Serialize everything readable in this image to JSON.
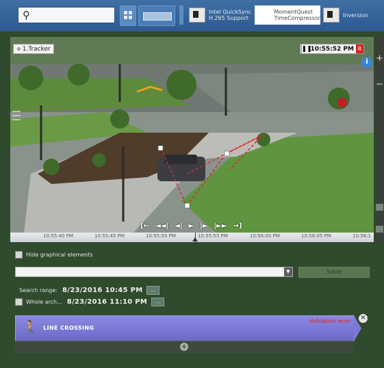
{
  "toolbar": {
    "search_placeholder": "",
    "plugins": [
      {
        "label_line1": "Intel QuickSync",
        "label_line2": "H.265 Support"
      },
      {
        "label_line1": "MomentQuest",
        "label_line2": "TimeCompressor"
      },
      {
        "label_line1": "Inversion",
        "label_line2": ""
      }
    ]
  },
  "camera": {
    "name": "1.Tracker",
    "time": "10:55:52 PM",
    "rec_badge": "R",
    "info_badge": "i"
  },
  "playback_controls": [
    "[←",
    "◄◄|",
    "◄|",
    "►",
    "|►",
    "|►►",
    "→]"
  ],
  "timeline": {
    "ticks": [
      "10:55:40 PM",
      "10:55:45 PM",
      "10:55:50 PM",
      "10:55:55 PM",
      "10:56:00 PM",
      "10:56:05 PM",
      "10:56:1"
    ]
  },
  "search_panel": {
    "hide_graphics_label": "Hide graphical elements",
    "save_label": "Save",
    "search_range_label": "Search range:",
    "search_range_value": "8/23/2016  10:45 PM",
    "whole_archive_label": "Whole arch...",
    "whole_archive_value": "8/23/2016  11:10 PM",
    "dots": "..."
  },
  "rule": {
    "title": "LINE CROSSING",
    "warning": "Validation error"
  },
  "colors": {
    "toolbar": "#3f6fa5",
    "panel_bg": "#2f4a2c",
    "rule_card": "#7b79d4",
    "rec_red": "#d42323"
  }
}
